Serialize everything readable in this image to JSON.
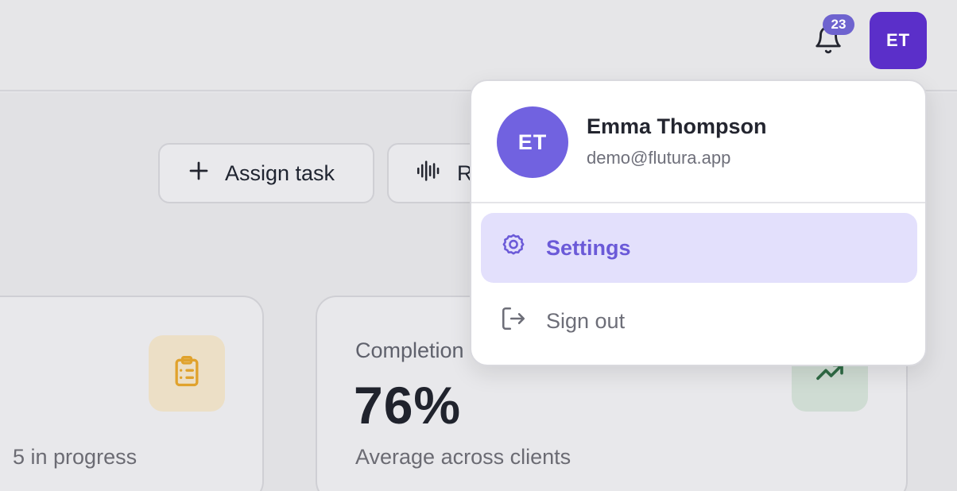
{
  "header": {
    "notifications_count": "23",
    "avatar_initials": "ET"
  },
  "actions": {
    "assign_task_label": "Assign task",
    "second_button_label": "R"
  },
  "cards": {
    "left": {
      "caption": "5 in progress"
    },
    "completion": {
      "label": "Completion",
      "value": "76%",
      "caption": "Average across clients"
    }
  },
  "user_menu": {
    "initials": "ET",
    "name": "Emma Thompson",
    "email": "demo@flutura.app",
    "settings_label": "Settings",
    "signout_label": "Sign out"
  },
  "icons": {
    "bell": "bell-icon",
    "plus": "plus-icon",
    "waveform": "waveform-icon",
    "clipboard": "clipboard-list-icon",
    "trend": "trending-up-icon",
    "gear": "gear-icon",
    "signout": "sign-out-icon"
  },
  "colors": {
    "brand": "#5b2fc9",
    "accent": "#6b5ad8",
    "avatar": "#7162e0",
    "badge": "#6e63cf",
    "settings_highlight": "#e3e0fc",
    "amber_tile": "#ecdfc6",
    "green_tile": "#cfdcd3"
  }
}
